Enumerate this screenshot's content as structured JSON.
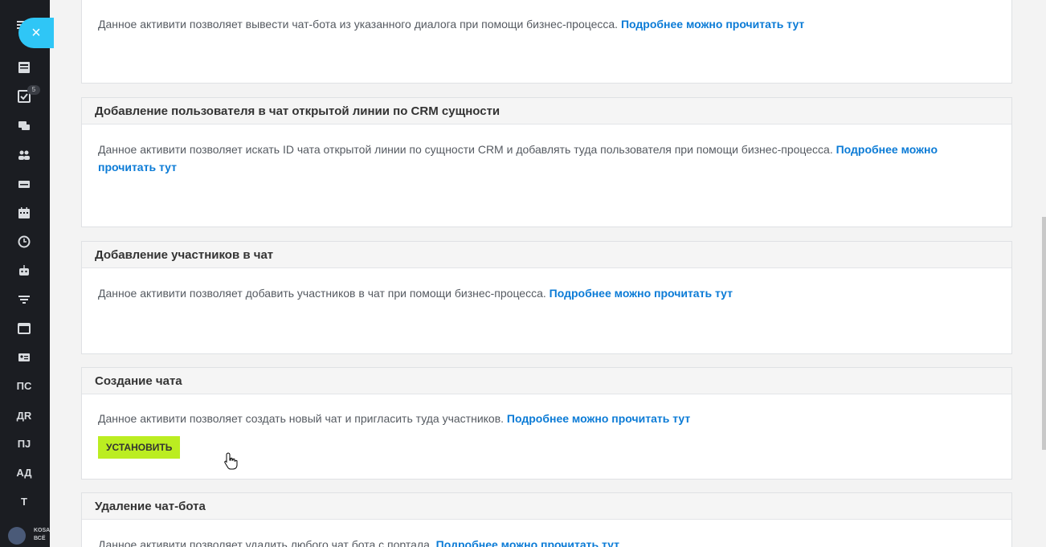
{
  "sidebar": {
    "close_label": "×",
    "badge_count": "5",
    "icons": [
      "news-icon",
      "tasks-icon",
      "chat-icon",
      "groups-icon",
      "crm-icon",
      "calendar-icon",
      "clock-icon",
      "robot-icon",
      "filter-icon",
      "window-icon",
      "contact-card-icon"
    ],
    "text_items": [
      "ПС",
      "ДR",
      "ПJ",
      "АД",
      "Т"
    ],
    "footer_line1": "KOSA",
    "footer_line2": "ВСЁ"
  },
  "cards": [
    {
      "title": "",
      "text": "Данное активити позволяет вывести чат-бота из указанного диалога при помощи бизнес-процесса. ",
      "link": "Подробнее можно прочитать тут"
    },
    {
      "title": "Добавление пользователя в чат открытой линии по CRM сущности",
      "text": "Данное активити позволяет искать ID чата открытой линии по сущности CRM и добавлять туда пользователя при помощи бизнес-процесса. ",
      "link": "Подробнее можно прочитать тут"
    },
    {
      "title": "Добавление участников в чат",
      "text": "Данное активити позволяет добавить участников в чат при помощи бизнес-процесса. ",
      "link": "Подробнее можно прочитать тут"
    },
    {
      "title": "Создание чата",
      "text": "Данное активити позволяет создать новый чат и пригласить туда участников. ",
      "link": "Подробнее можно прочитать тут",
      "button": "УСТАНОВИТЬ"
    },
    {
      "title": "Удаление чат-бота",
      "text": "Данное активити позволяет удалить любого чат бота с портала. ",
      "link": "Подробнее можно прочитать тут"
    }
  ],
  "colors": {
    "sidebar_bg": "#1b1d22",
    "accent": "#2fc6f6",
    "link": "#0b7bd6",
    "install_button": "#bbed21"
  }
}
